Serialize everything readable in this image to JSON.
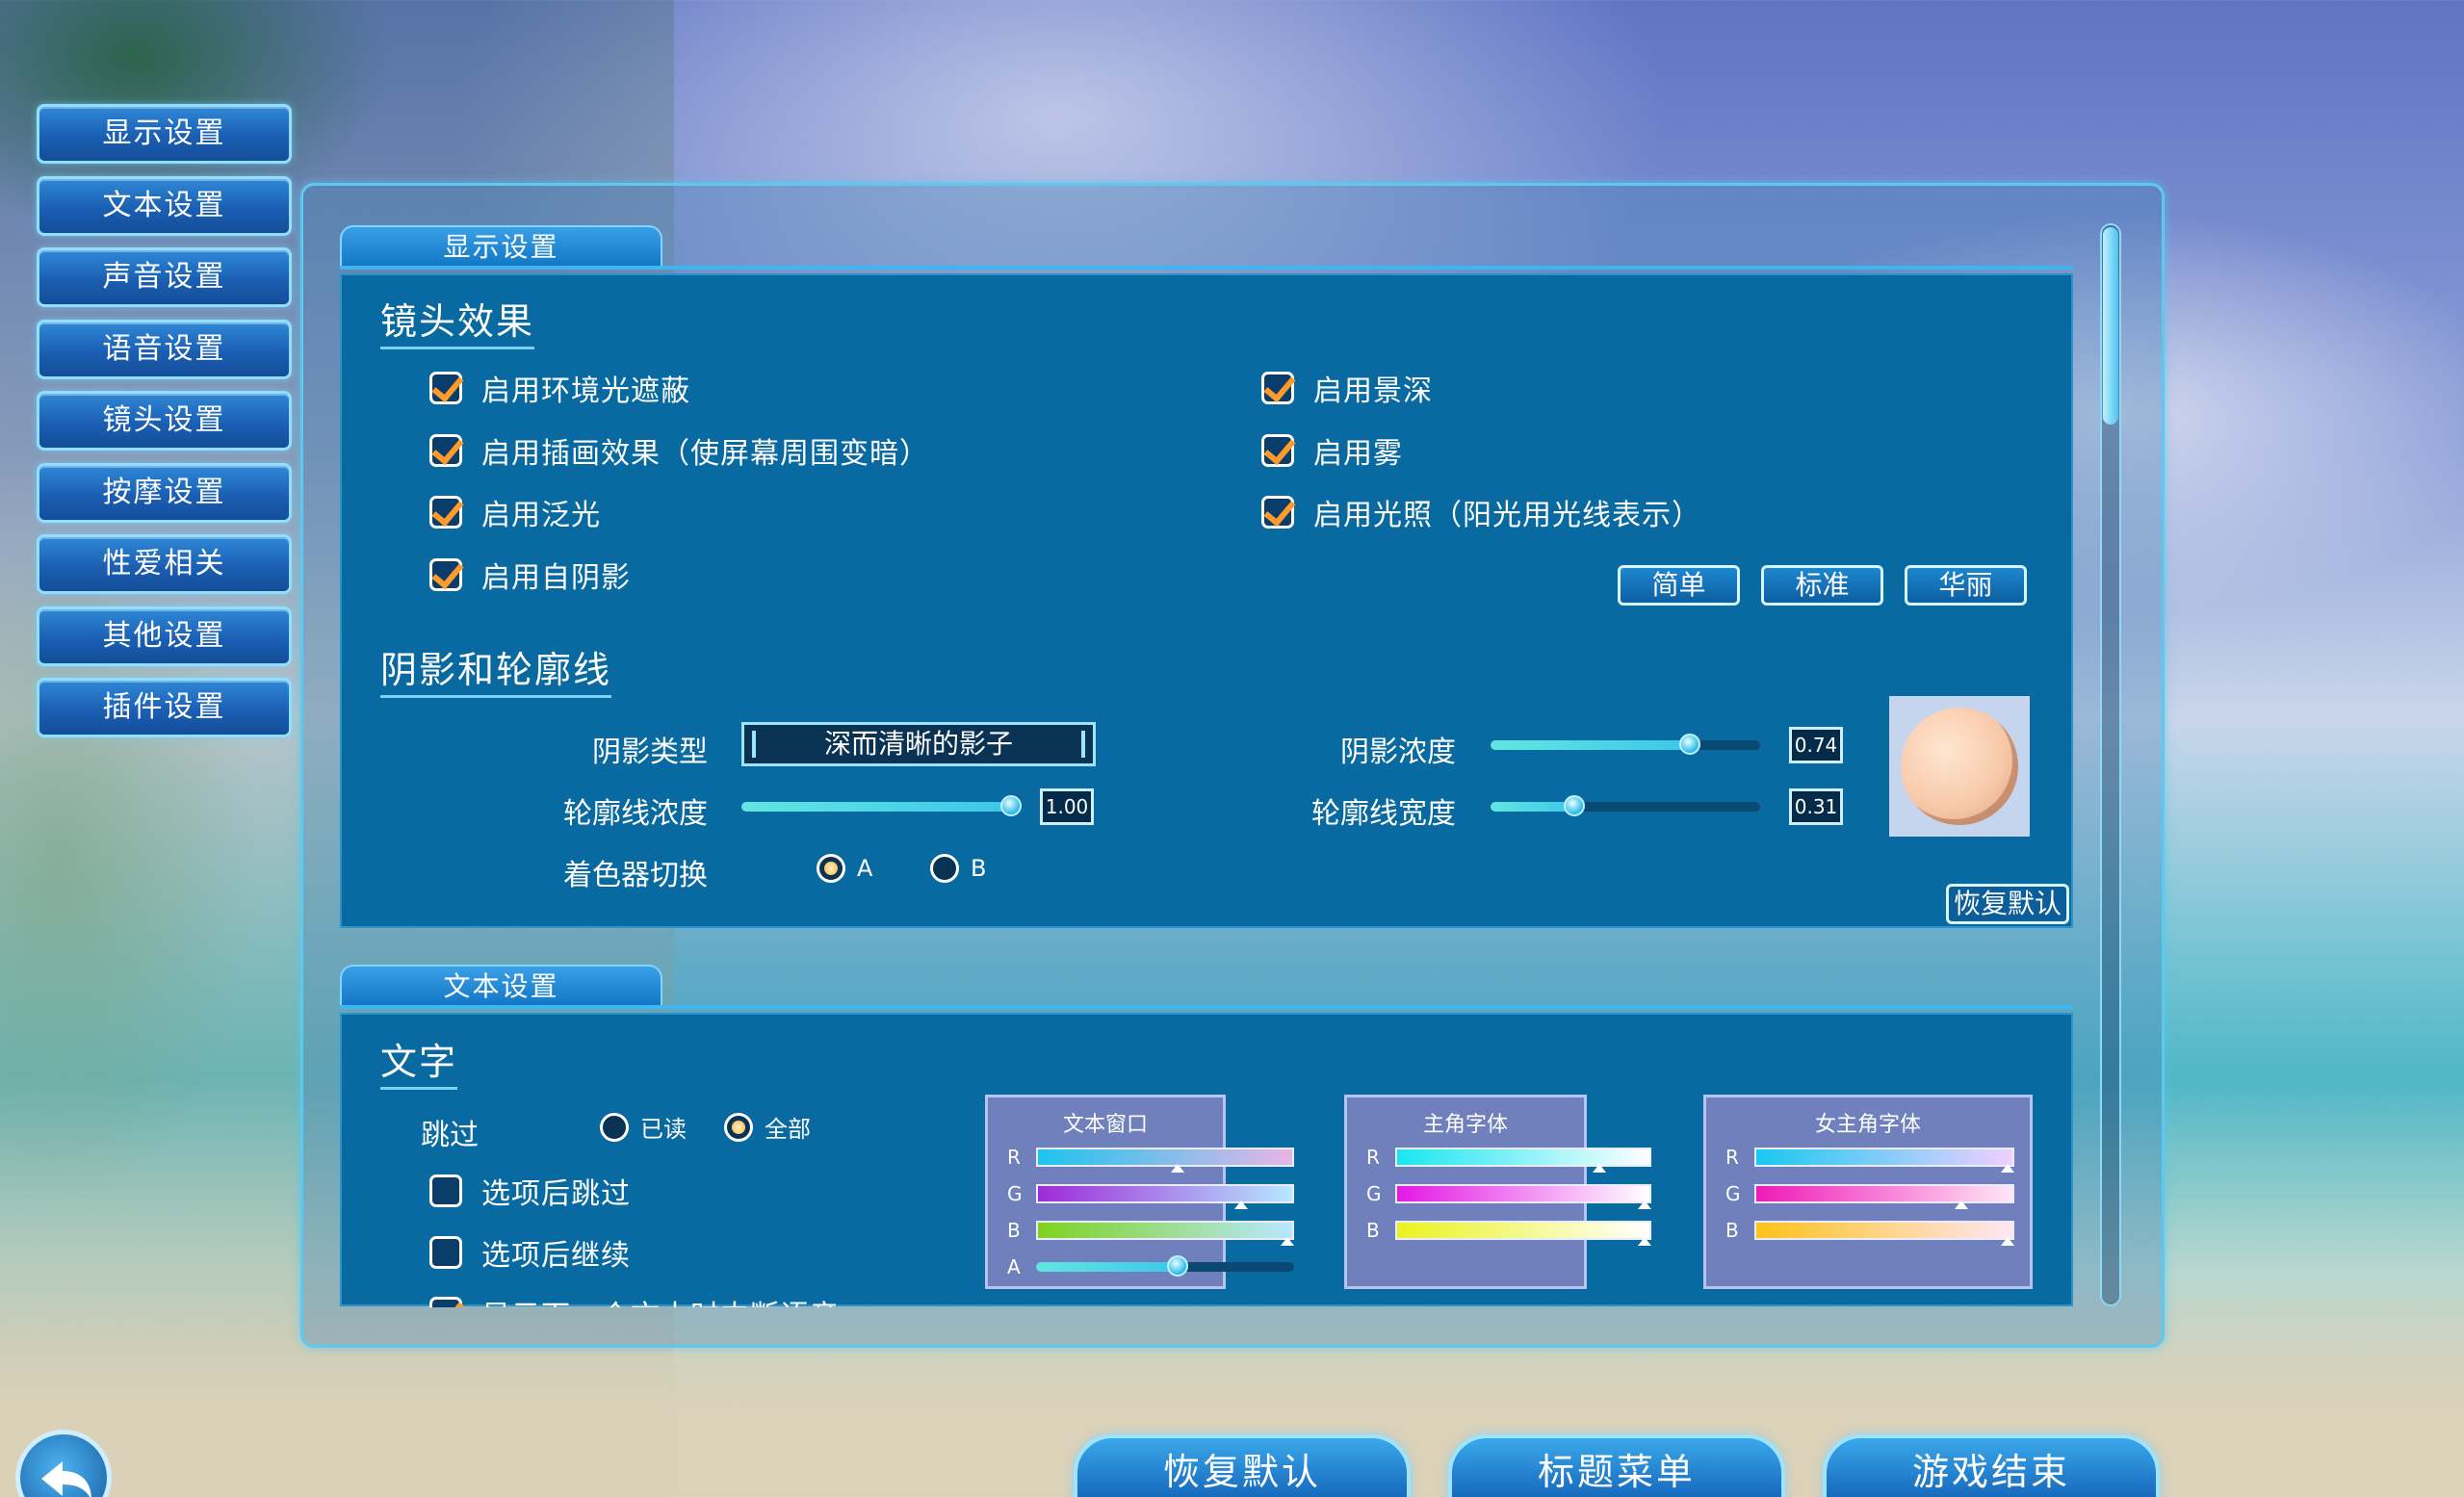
{
  "sidebar": {
    "items": [
      {
        "label": "显示设置"
      },
      {
        "label": "文本设置"
      },
      {
        "label": "声音设置"
      },
      {
        "label": "语音设置"
      },
      {
        "label": "镜头设置"
      },
      {
        "label": "按摩设置"
      },
      {
        "label": "性爱相关"
      },
      {
        "label": "其他设置"
      },
      {
        "label": "插件设置"
      }
    ]
  },
  "display": {
    "tab": "显示设置",
    "lens_title": "镜头效果",
    "left_checks": [
      {
        "label": "启用环境光遮蔽",
        "checked": true
      },
      {
        "label": "启用插画效果（使屏幕周围变暗）",
        "checked": true
      },
      {
        "label": "启用泛光",
        "checked": true
      },
      {
        "label": "启用自阴影",
        "checked": true
      }
    ],
    "right_checks": [
      {
        "label": "启用景深",
        "checked": true
      },
      {
        "label": "启用雾",
        "checked": true
      },
      {
        "label": "启用光照（阳光用光线表示）",
        "checked": true
      }
    ],
    "presets": {
      "simple": "简单",
      "standard": "标准",
      "gorgeous": "华丽"
    },
    "shadow_title": "阴影和轮廓线",
    "shadow_type_label": "阴影类型",
    "shadow_type_value": "深而清晰的影子",
    "outline_density_label": "轮廓线浓度",
    "outline_density_value": "1.00",
    "outline_density": 1.0,
    "shader_label": "着色器切换",
    "shader_a": "A",
    "shader_b": "B",
    "shader_selected": "A",
    "shadow_density_label": "阴影浓度",
    "shadow_density_value": "0.74",
    "shadow_density": 0.74,
    "outline_width_label": "轮廓线宽度",
    "outline_width_value": "0.31",
    "outline_width": 0.31,
    "restore_label": "恢复默认"
  },
  "text": {
    "tab": "文本设置",
    "text_title": "文字",
    "skip_label": "跳过",
    "skip_read": "已读",
    "skip_all": "全部",
    "skip_selected": "全部",
    "checks": [
      {
        "label": "选项后跳过",
        "checked": false
      },
      {
        "label": "选项后继续",
        "checked": false
      },
      {
        "label": "显示下一个文本时中断语音",
        "checked": true
      }
    ],
    "color_panels": [
      {
        "title": "文本窗口",
        "channels": [
          "R",
          "G",
          "B",
          "A"
        ],
        "levels": [
          0.55,
          0.8,
          0.98,
          0.55
        ]
      },
      {
        "title": "主角字体",
        "channels": [
          "R",
          "G",
          "B"
        ],
        "levels": [
          0.8,
          0.98,
          0.98
        ]
      },
      {
        "title": "女主角字体",
        "channels": [
          "R",
          "G",
          "B"
        ],
        "levels": [
          0.98,
          0.8,
          0.98
        ]
      }
    ]
  },
  "bottom": {
    "restore": "恢复默认",
    "title_menu": "标题菜单",
    "quit": "游戏结束"
  },
  "icons": {
    "back": "back-arrow-icon"
  },
  "colors": {
    "accent": "#3fb6ef",
    "panel": "#086aa0",
    "check": "#ff9b2b"
  }
}
